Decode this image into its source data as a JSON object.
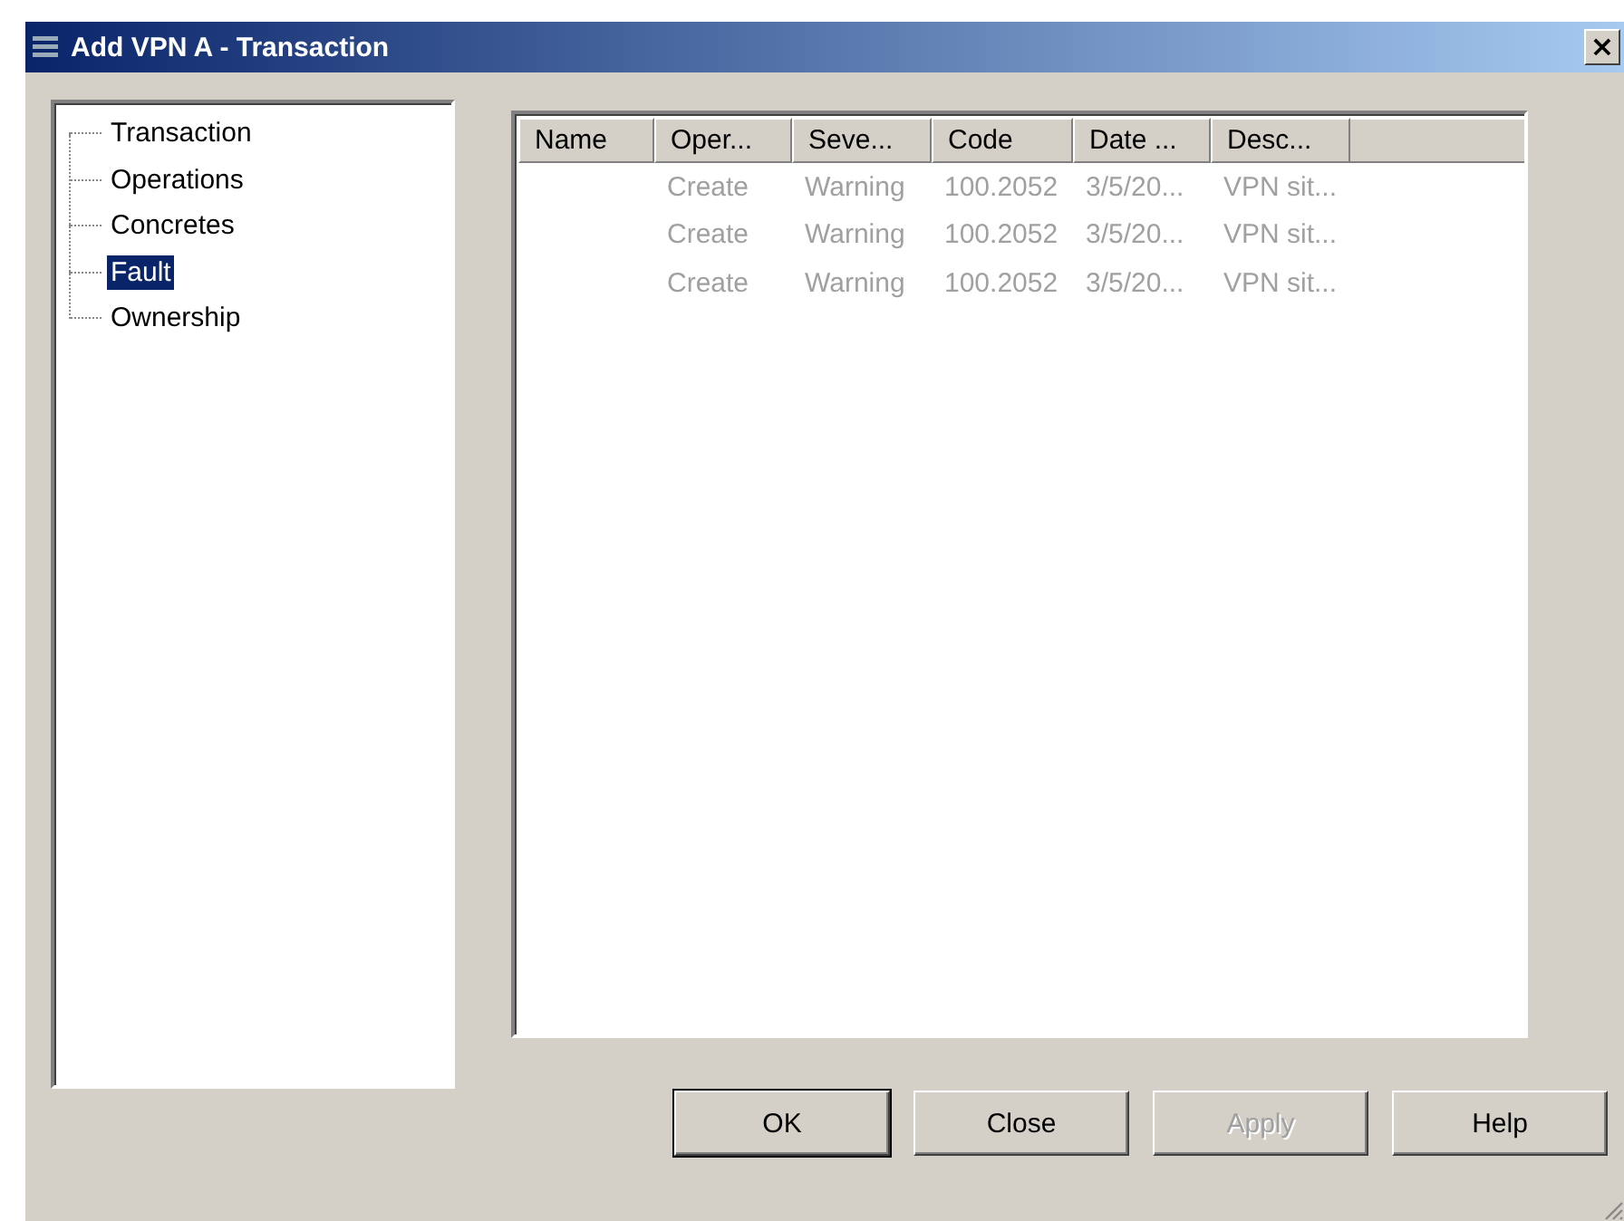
{
  "window": {
    "title": "Add VPN A - Transaction",
    "close": "×"
  },
  "tree": {
    "items": [
      {
        "label": "Transaction",
        "selected": false
      },
      {
        "label": "Operations",
        "selected": false
      },
      {
        "label": "Concretes",
        "selected": false
      },
      {
        "label": "Fault",
        "selected": true
      },
      {
        "label": "Ownership",
        "selected": false
      }
    ]
  },
  "table": {
    "columns": [
      "Name",
      "Oper...",
      "Seve...",
      "Code",
      "Date ...",
      "Desc..."
    ],
    "rows": [
      {
        "disabled": true,
        "cells": [
          "",
          "Create",
          "Warning",
          "100.2052",
          "3/5/20...",
          "VPN sit..."
        ]
      },
      {
        "disabled": true,
        "cells": [
          "",
          "Create",
          "Warning",
          "100.2052",
          "3/5/20...",
          "VPN sit..."
        ]
      },
      {
        "disabled": true,
        "cells": [
          "",
          "Create",
          "Warning",
          "100.2052",
          "3/5/20...",
          "VPN sit..."
        ]
      }
    ]
  },
  "buttons": [
    {
      "label": "OK",
      "disabled": false,
      "default": true
    },
    {
      "label": "Close",
      "disabled": false,
      "default": false
    },
    {
      "label": "Apply",
      "disabled": true,
      "default": false
    },
    {
      "label": "Help",
      "disabled": false,
      "default": false
    }
  ]
}
